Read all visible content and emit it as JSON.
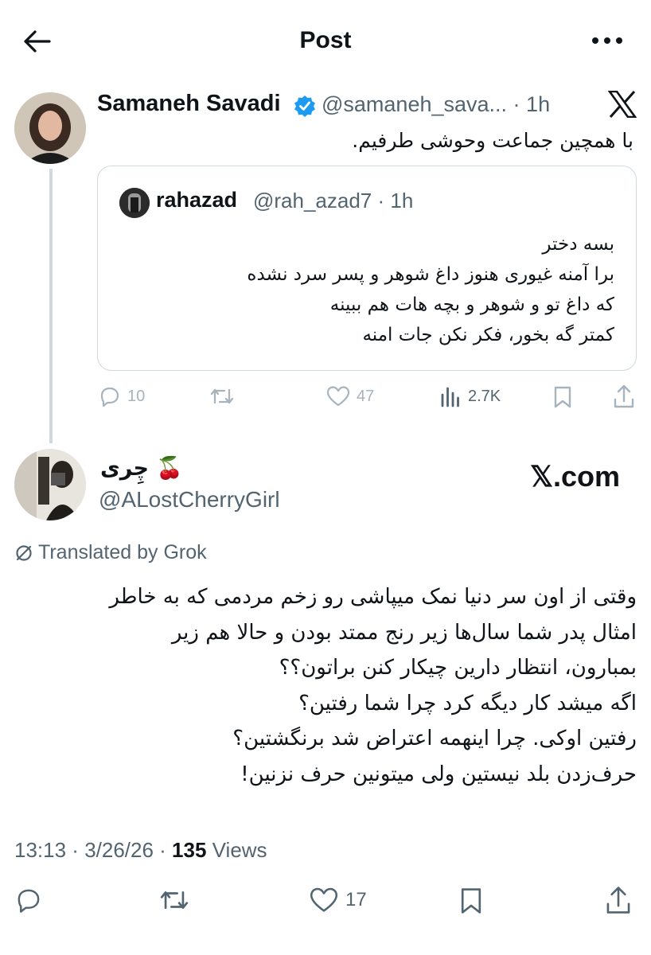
{
  "header": {
    "title": "Post"
  },
  "parent_post": {
    "author_name": "Samaneh Savadi",
    "author_handle": "@samaneh_sava...",
    "time": "1h",
    "text": "با همچین جماعت وحوشی طرفیم.",
    "quoted": {
      "author_name": "rahazad",
      "author_handle": "@rah_azad7",
      "time": "1h",
      "lines": [
        "بسه دختر",
        "برا آمنه غیوری هنوز داغ شوهر و پسر سرد نشده",
        "که داغ تو و شوهر و بچه هات هم ببینه",
        "کمتر گه بخور،  فکر نکن جات امنه"
      ]
    },
    "actions": {
      "replies": "10",
      "reposts": "",
      "likes": "47",
      "views": "2.7K"
    }
  },
  "main_post": {
    "author_name": "چِری 🍒",
    "author_handle": "@ALostCherryGirl",
    "watermark": "𝕏.com",
    "translated_label": "Translated by Grok",
    "lines": [
      "وقتی از اون سر دنیا نمک میپاشی رو زخم مردمی که به خاطر",
      "امثال پدر شما سال‌ها زیر رنج ممتد بودن و حالا هم زیر",
      "بمبارون، انتظار دارین چیکار کنن براتون؟؟",
      "اگه میشد کار دیگه کرد چرا شما رفتین؟",
      "رفتین اوکی. چرا اینهمه اعتراض شد برنگشتین؟",
      "حرف‌زدن بلد نیستین ولی میتونین حرف نزنین!"
    ],
    "time": "13:13",
    "date": "3/26/26",
    "views_count": "135",
    "views_label": "Views",
    "actions": {
      "likes": "17"
    }
  },
  "colors": {
    "text": "#0f1419",
    "muted": "#536471",
    "verified": "#1d9bf0",
    "border": "#cfd9de"
  }
}
